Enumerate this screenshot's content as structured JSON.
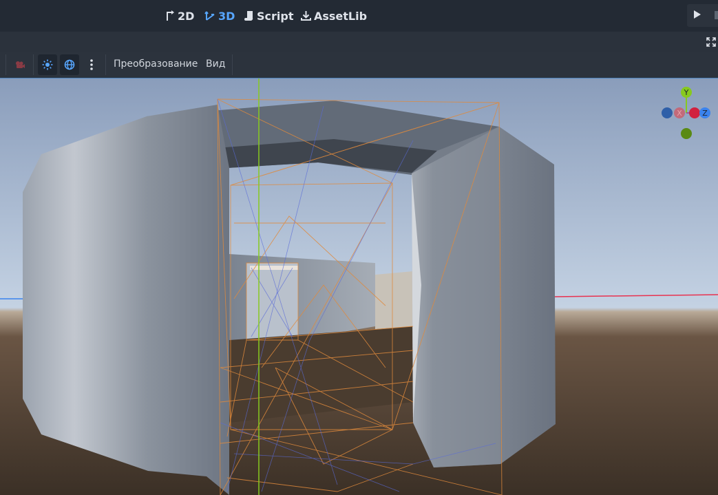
{
  "workspace": {
    "items": [
      {
        "label": "2D",
        "icon": "2d-workspace-icon",
        "active": false
      },
      {
        "label": "3D",
        "icon": "3d-workspace-icon",
        "active": true
      },
      {
        "label": "Script",
        "icon": "script-icon",
        "active": false
      },
      {
        "label": "AssetLib",
        "icon": "download-icon",
        "active": false
      }
    ],
    "play_icon": "play-icon"
  },
  "toolbar": {
    "transform_menu": "Преобразование",
    "view_menu": "Вид",
    "icons": [
      "camera-icon",
      "sun-preview-icon",
      "environment-preview-icon",
      "more-options-icon"
    ]
  },
  "gizmo": {
    "y_label": "Y",
    "x_label": "X",
    "z_label": "Z",
    "colors": {
      "x": "#e8314f",
      "y": "#87c91e",
      "z": "#3b83ee"
    }
  },
  "colors": {
    "accent": "#57a6ff",
    "sky_top": "#8a9dbb",
    "ground": "#3f3328",
    "wall": "#7c8592",
    "wireframe": "#e08a3c"
  }
}
